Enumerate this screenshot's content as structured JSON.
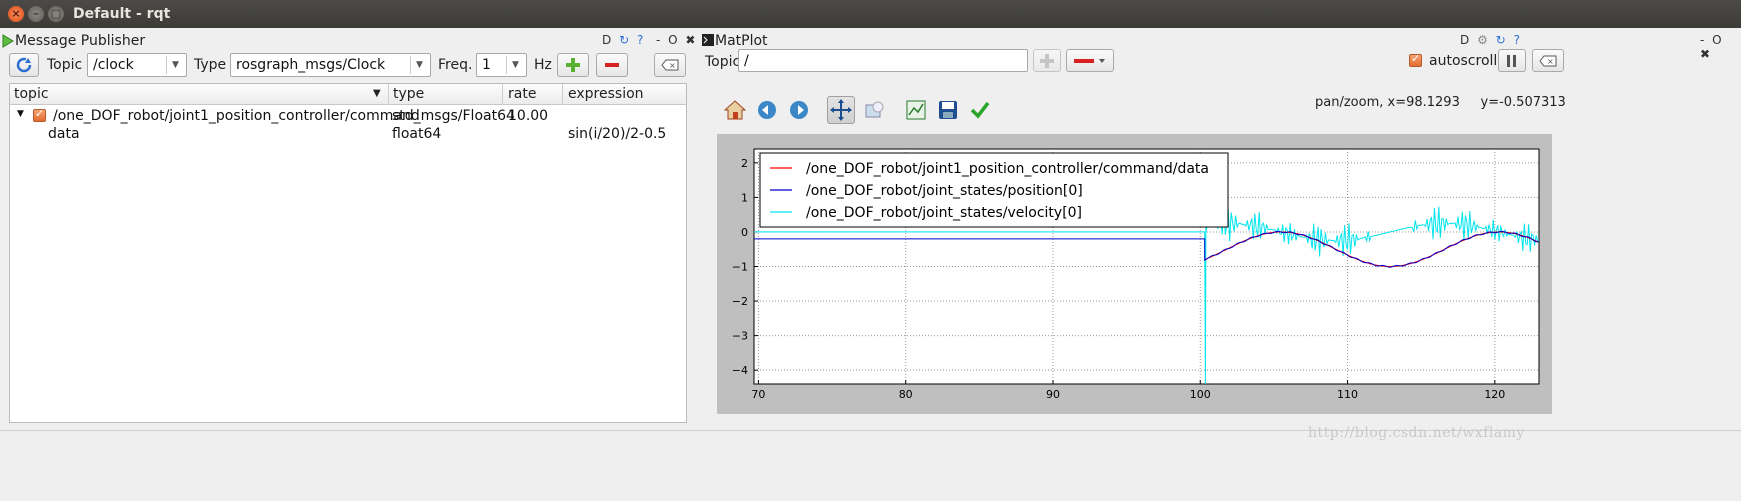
{
  "window": {
    "title": "Default - rqt"
  },
  "publisher": {
    "title": "Message Publisher",
    "header_tools": "D",
    "dash": "- O",
    "topic_label": "Topic",
    "topic_value": "/clock",
    "type_label": "Type",
    "type_value": "rosgraph_msgs/Clock",
    "freq_label": "Freq.",
    "freq_value": "1",
    "hz_label": "Hz",
    "columns": [
      "topic",
      "type",
      "rate",
      "expression"
    ],
    "rows": [
      {
        "topic": "/one_DOF_robot/joint1_position_controller/command",
        "type": "std_msgs/Float64",
        "rate": "10.00",
        "expression": ""
      },
      {
        "topic": "data",
        "type": "float64",
        "rate": "",
        "expression": "sin(i/20)/2-0.5"
      }
    ]
  },
  "matplot": {
    "title": "MatPlot",
    "header_tools": "D",
    "dash": "- O",
    "topic_label": "Topic",
    "topic_value": "/",
    "autoscroll_label": "autoscroll",
    "coords": "pan/zoom, x=98.1293     y=-0.507313"
  },
  "watermark": "http://blog.csdn.net/wxflamy",
  "chart_data": {
    "type": "line",
    "xlim": [
      69.7,
      123.0
    ],
    "ylim": [
      -4.4,
      2.4
    ],
    "xticks": [
      70,
      80,
      90,
      100,
      110,
      120
    ],
    "yticks": [
      2,
      1,
      0,
      -1,
      -2,
      -3,
      -4
    ],
    "grid": true,
    "legend_position": "top-left",
    "series": [
      {
        "name": "/one_DOF_robot/joint1_position_controller/command/data",
        "color": "#ff0000"
      },
      {
        "name": "/one_DOF_robot/joint_states/position[0]",
        "color": "#0000cc"
      },
      {
        "name": "/one_DOF_robot/joint_states/velocity[0]",
        "color": "#00e5ee"
      }
    ],
    "pre_start_value_position": -0.2,
    "pre_start_value_velocity": 0.0,
    "start_x": 100.3,
    "signal": "sin(i/20)/2-0.5"
  },
  "colors": {
    "accent": "#e26b32",
    "plot_bg": "#bfbfbf",
    "titlebar": "#3c3b37"
  }
}
